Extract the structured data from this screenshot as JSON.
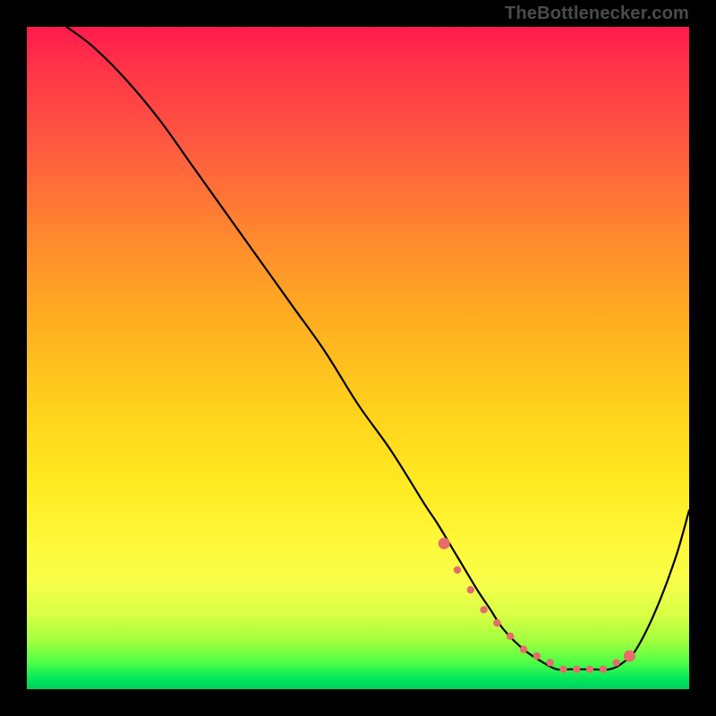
{
  "attribution": "TheBottlenecker.com",
  "colors": {
    "background": "#000000",
    "curve": "#000000",
    "marker": "#e86a6a",
    "gradient_stops": [
      "#ff1a4d",
      "#ff5a40",
      "#ffb020",
      "#ffe820",
      "#d6ff44",
      "#00e85a"
    ]
  },
  "chart_data": {
    "type": "line",
    "title": "",
    "xlabel": "",
    "ylabel": "",
    "xlim": [
      0,
      100
    ],
    "ylim": [
      0,
      100
    ],
    "grid": false,
    "legend": false,
    "note": "Axis scales are not labeled in the source image; x normalized 0–100 left→right, y normalized 0–100 where 0 is the chart bottom (green) and 100 is the top (red). Values are visual estimates.",
    "series": [
      {
        "name": "bottleneck-curve",
        "x": [
          6,
          10,
          15,
          20,
          25,
          30,
          35,
          40,
          45,
          50,
          55,
          60,
          62,
          65,
          68,
          70,
          72,
          75,
          78,
          80,
          82,
          85,
          88,
          90,
          92,
          95,
          98,
          100
        ],
        "y": [
          100,
          97,
          92,
          86,
          79,
          72,
          65,
          58,
          51,
          43,
          36,
          28,
          25,
          20,
          15,
          12,
          9,
          6,
          4,
          3,
          3,
          3,
          3,
          4,
          6,
          12,
          20,
          27
        ]
      }
    ],
    "markers": {
      "name": "highlighted-range",
      "x": [
        63,
        65,
        67,
        69,
        71,
        73,
        75,
        77,
        79,
        81,
        83,
        85,
        87,
        89,
        91
      ],
      "y": [
        22,
        18,
        15,
        12,
        10,
        8,
        6,
        5,
        4,
        3,
        3,
        3,
        3,
        4,
        5
      ]
    }
  }
}
